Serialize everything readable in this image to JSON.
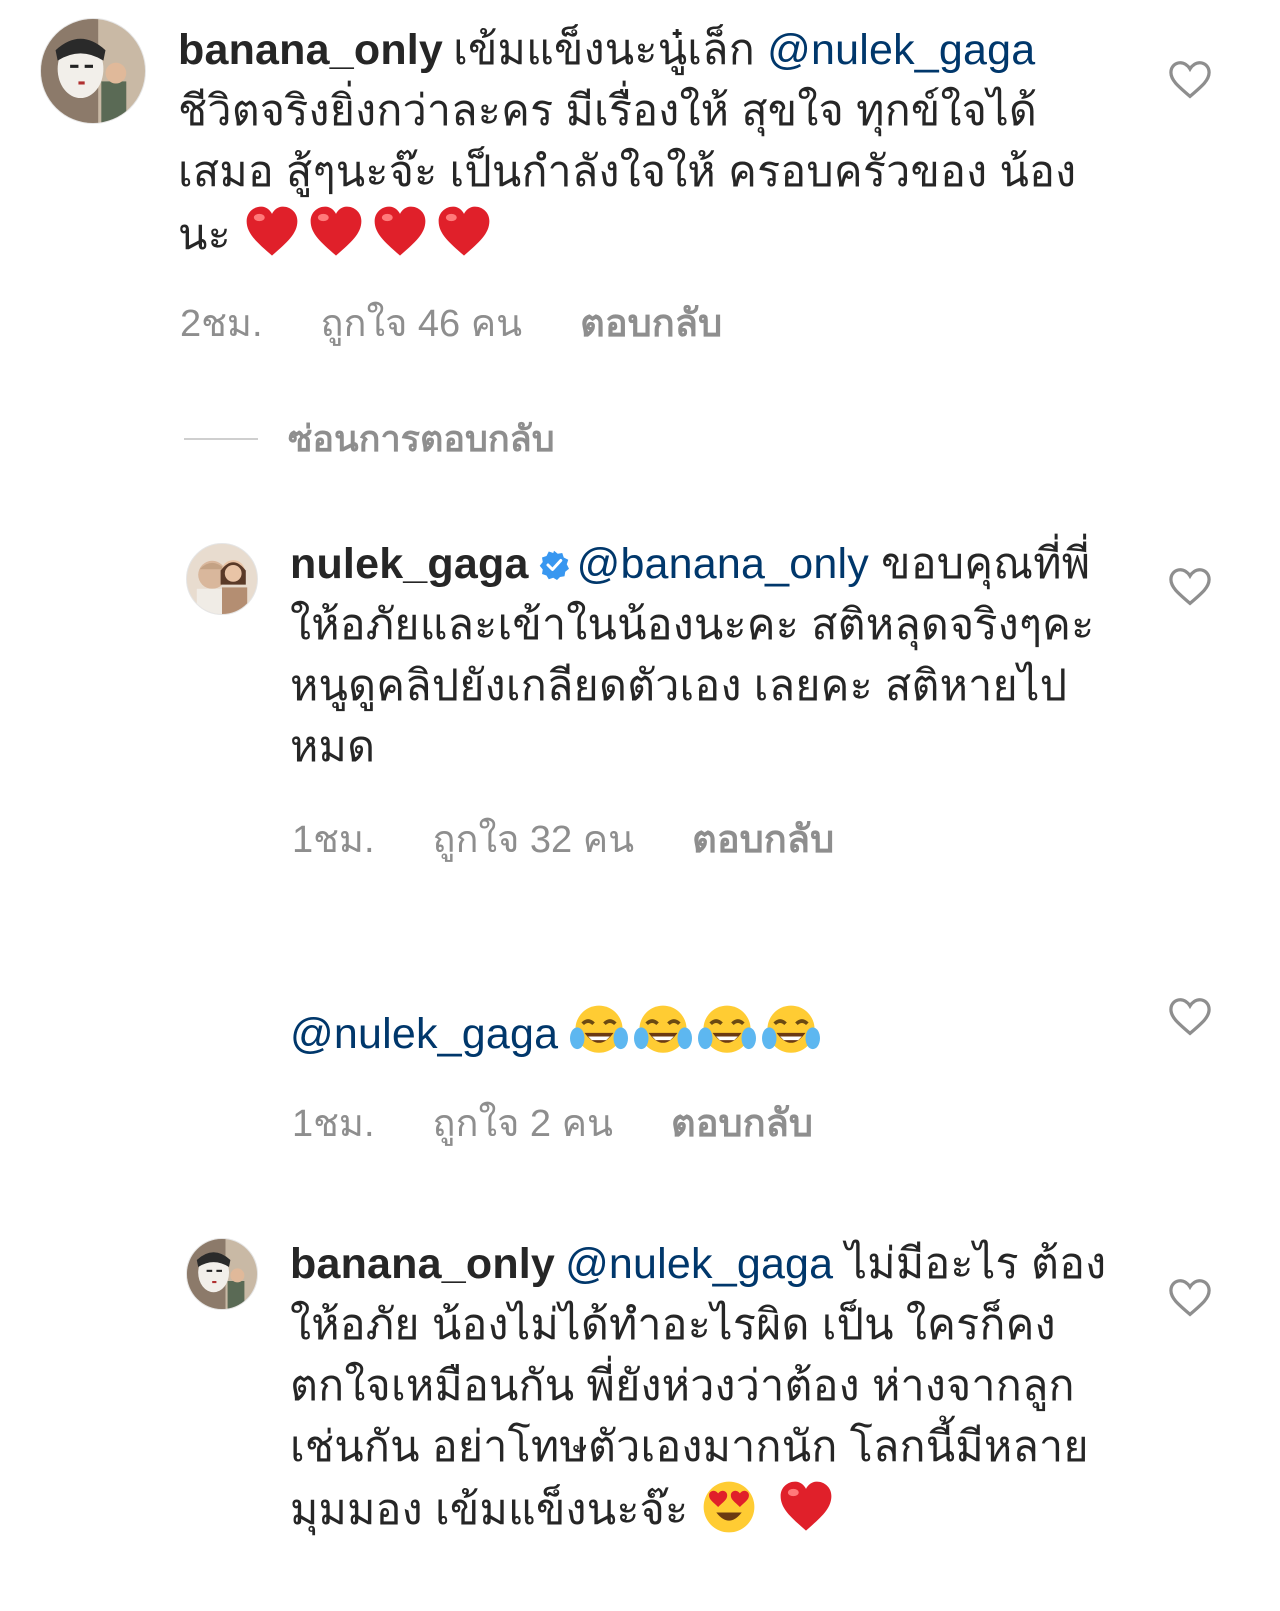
{
  "comments": [
    {
      "username": "banana_only",
      "text_1": "เข้มแข็งนะนู๋เล็ก",
      "mention": "@nulek_gaga",
      "text_2": "ชีวิตจริงยิ่งกว่าละคร  มีเรื่องให้ สุขใจ ทุกข์ใจได้ เสมอ  สู้ๆนะจ๊ะ  เป็นกำลังใจให้ ครอบครัวของ น้องนะ",
      "emojis": [
        "heart-emoji",
        "heart-emoji",
        "heart-emoji",
        "heart-emoji"
      ],
      "time": "2ชม.",
      "likes": "ถูกใจ 46 คน",
      "reply": "ตอบกลับ"
    },
    {
      "username": "nulek_gaga",
      "verified": true,
      "mention": "@banana_only",
      "text": "ขอบคุณที่พี่ให้อภัยและเข้าในน้องนะคะ สติหลุดจริงๆคะ หนูดูคลิปยังเกลียดตัวเอง เลยคะ สติหายไปหมด",
      "time": "1ชม.",
      "likes": "ถูกใจ 32 คน",
      "reply": "ตอบกลับ"
    },
    {
      "mention": "@nulek_gaga",
      "emojis": [
        "tears-of-joy-emoji",
        "tears-of-joy-emoji",
        "tears-of-joy-emoji",
        "tears-of-joy-emoji"
      ],
      "time": "1ชม.",
      "likes": "ถูกใจ 2 คน",
      "reply": "ตอบกลับ"
    },
    {
      "username": "banana_only",
      "mention": "@nulek_gaga",
      "text": "ไม่มีอะไร ต้องให้อภัย  น้องไม่ได้ทำอะไรผิด  เป็น ใครก็คงตกใจเหมือนกัน  พี่ยังห่วงว่าต้อง ห่างจากลูกเช่นกัน  อย่าโทษตัวเองมากนัก โลกนี้มีหลายมุมมอง  เข้มแข็งนะจ๊ะ",
      "emojis": [
        "heart-eyes-emoji",
        "heart-emoji"
      ]
    }
  ],
  "hide_replies": "ซ่อนการตอบกลับ",
  "colors": {
    "text": "#262626",
    "mention": "#00376b",
    "meta": "#8e8e8e",
    "verified": "#3897f0",
    "heart": "#e0202a"
  }
}
